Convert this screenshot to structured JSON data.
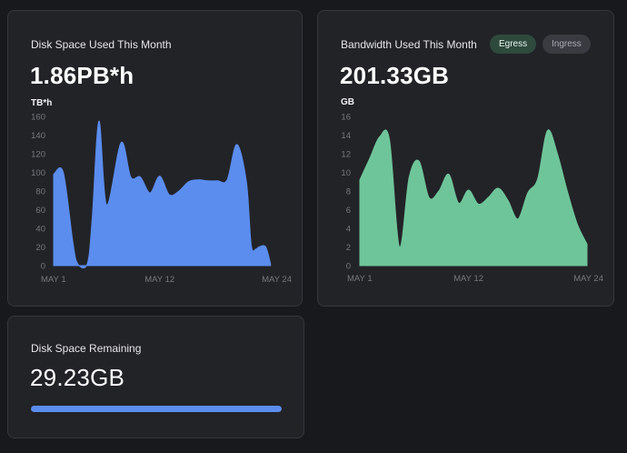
{
  "cards": {
    "disk_used": {
      "title": "Disk Space Used This Month",
      "value": "1.86PB*h",
      "unit": "TB*h"
    },
    "bandwidth": {
      "title": "Bandwidth Used This Month",
      "value": "201.33GB",
      "unit": "GB",
      "toggles": [
        {
          "label": "Egress",
          "selected": true
        },
        {
          "label": "Ingress",
          "selected": false
        }
      ]
    },
    "remaining": {
      "title": "Disk Space Remaining",
      "value": "29.23GB",
      "progress": 1.0
    }
  },
  "colors": {
    "disk_series": "#5b8def",
    "bandwidth_series": "#6fc59a",
    "progress": "#5b8def"
  },
  "chart_data": [
    {
      "type": "area",
      "ylabel": "TB*h",
      "ylim": [
        0,
        160
      ],
      "yticks": [
        0,
        20,
        40,
        60,
        80,
        100,
        120,
        140,
        160
      ],
      "xlim": [
        1,
        24
      ],
      "xticks": [
        {
          "x": 1,
          "label": "MAY 1"
        },
        {
          "x": 12,
          "label": "MAY 12"
        },
        {
          "x": 24,
          "label": "MAY 24"
        }
      ],
      "grid": false,
      "series": [
        {
          "x": [
            1,
            2,
            3,
            3.5,
            4.5,
            5,
            5.7,
            6.5,
            8,
            9,
            10,
            11,
            12,
            13,
            14,
            15,
            16,
            17,
            18,
            19,
            20,
            21,
            21.5,
            22,
            22.3,
            23,
            23.5
          ],
          "y": [
            98,
            100,
            25,
            2,
            2,
            50,
            155,
            65,
            132,
            95,
            95,
            78,
            96,
            76,
            80,
            90,
            92,
            91,
            91,
            92,
            130,
            90,
            22,
            18,
            20,
            20,
            2
          ]
        }
      ]
    },
    {
      "type": "area",
      "ylabel": "GB",
      "ylim": [
        0,
        16
      ],
      "yticks": [
        0,
        2,
        4,
        6,
        8,
        10,
        12,
        14,
        16
      ],
      "xlim": [
        1,
        24
      ],
      "xticks": [
        {
          "x": 1,
          "label": "MAY 1"
        },
        {
          "x": 12,
          "label": "MAY 12"
        },
        {
          "x": 24,
          "label": "MAY 24"
        }
      ],
      "grid": false,
      "series": [
        {
          "x": [
            1,
            2,
            3,
            4,
            5,
            6,
            7,
            8,
            9,
            10,
            11,
            12,
            13,
            14,
            15,
            16,
            17,
            18,
            19,
            20,
            21,
            22,
            23,
            24
          ],
          "y": [
            9.2,
            11.5,
            13.8,
            13.5,
            2.0,
            9.5,
            11.2,
            7.3,
            8.0,
            9.8,
            6.7,
            8.1,
            6.6,
            7.3,
            8.3,
            7.0,
            5.0,
            7.8,
            9.3,
            14.5,
            12.0,
            8.0,
            4.5,
            2.3
          ]
        }
      ]
    }
  ]
}
